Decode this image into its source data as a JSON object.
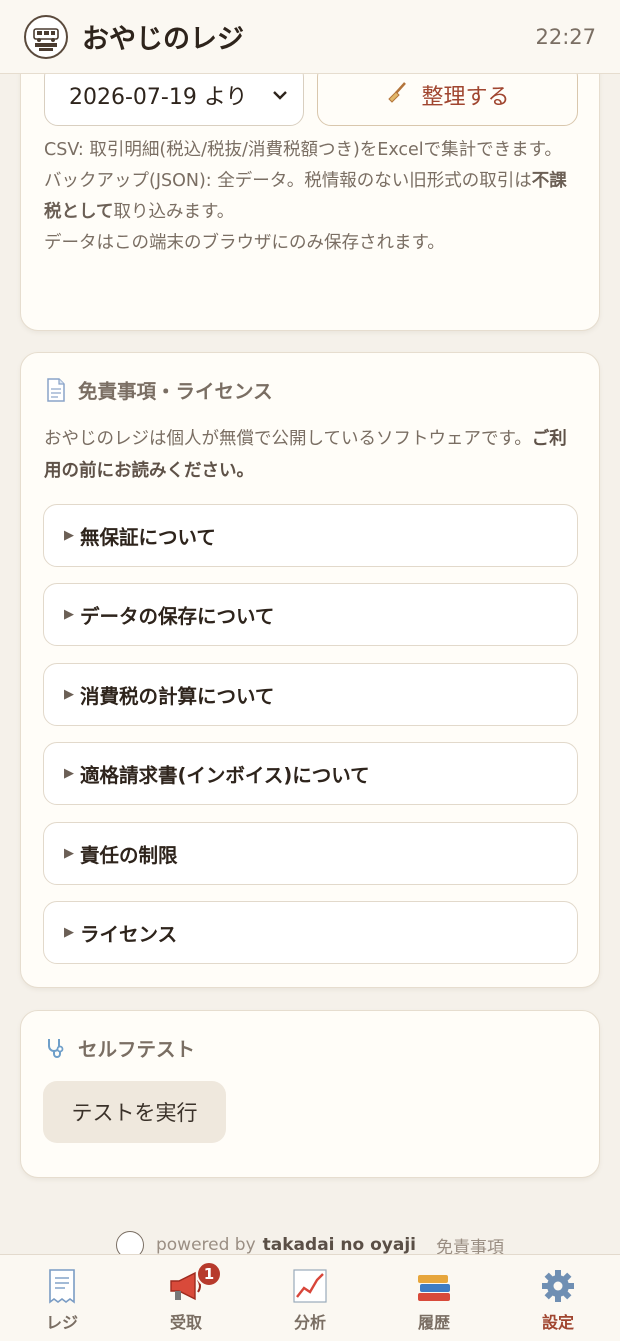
{
  "header": {
    "title": "おやじのレジ",
    "time": "22:27"
  },
  "data_card": {
    "date_select_value": "2026-07-19 より",
    "cleanup_label": "整理する",
    "notes": [
      "CSV: 取引明細(税込/税抜/消費税額つき)をExcelで集計できます。",
      "バックアップ(JSON): 全データ。税情報のない旧形式の取引は",
      "不課税として",
      "取り込みます。",
      "データはこの端末のブラウザにのみ保存されます。"
    ]
  },
  "disclaimer": {
    "heading": "免責事項・ライセンス",
    "desc_plain": "おやじのレジは個人が無償で公開しているソフトウェアです。",
    "desc_bold": "ご利用の前にお読みください。",
    "items": [
      "無保証について",
      "データの保存について",
      "消費税の計算について",
      "適格請求書(インボイス)について",
      "責任の制限",
      "ライセンス"
    ]
  },
  "selftest": {
    "heading": "セルフテスト",
    "button_label": "テストを実行"
  },
  "footer": {
    "powered_by": "powered by",
    "brand": "takadai no oyaji",
    "disclaimer_link": "免責事項"
  },
  "tabs": [
    {
      "label": "レジ",
      "icon": "receipt-icon"
    },
    {
      "label": "受取",
      "icon": "megaphone-icon",
      "badge": "1"
    },
    {
      "label": "分析",
      "icon": "chart-icon"
    },
    {
      "label": "履歴",
      "icon": "books-icon"
    },
    {
      "label": "設定",
      "icon": "gear-icon",
      "active": true
    }
  ],
  "colors": {
    "accent": "#a0452f",
    "badge": "#b73a2c",
    "background": "#f5f1ea"
  }
}
